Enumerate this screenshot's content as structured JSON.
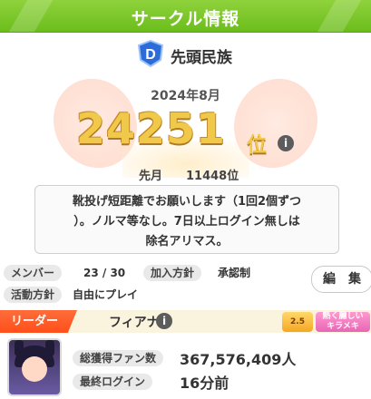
{
  "header": {
    "title": "サークル情報"
  },
  "circle": {
    "name": "先頭民族",
    "month": "2024年8月",
    "rank": "24251",
    "rank_suffix": "位",
    "last_month_label": "先月",
    "last_month_value": "11448位",
    "description_lines": [
      "靴投げ短距離でお願いします（1回2個ずつ",
      "）。ノルマ等なし。7日以上ログイン無しは",
      "除名アリマス。"
    ]
  },
  "info": {
    "members_label": "メンバー",
    "members_value": "23 / 30",
    "join_label": "加入方針",
    "join_value": "承認制",
    "activity_label": "活動方針",
    "activity_value": "自由にプレイ",
    "edit_label": "編　集"
  },
  "leader": {
    "tag": "リーダー",
    "name": "フィアナ",
    "badge1": "2.5",
    "badge2_line1": "熱く麗しい",
    "badge2_line2": "キラメキ",
    "fans_label": "総獲得ファン数",
    "fans_value": "367,576,409人",
    "login_label": "最終ログイン",
    "login_value": "16分前"
  },
  "icons": {
    "info": "info-icon",
    "emblem": "circle-emblem-icon"
  },
  "colors": {
    "header": "#7cc628",
    "rank_gold": "#f0c84a",
    "leader_tag": "#ff5a24"
  }
}
